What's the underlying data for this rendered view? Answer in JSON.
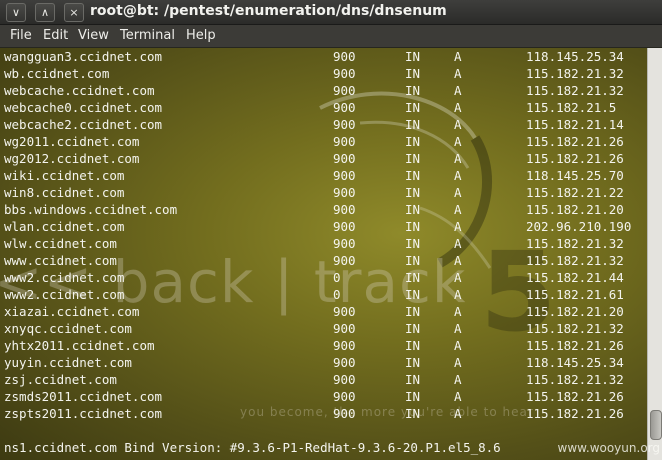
{
  "window": {
    "title": "root@bt: /pentest/enumeration/dns/dnsenum",
    "buttons": [
      "∨",
      "∧",
      "×"
    ]
  },
  "menu": [
    "File",
    "Edit",
    "View",
    "Terminal",
    "Help"
  ],
  "records": [
    {
      "host": "wangguan3.ccidnet.com",
      "ttl": "900",
      "class": "IN",
      "type": "A",
      "ip": "118.145.25.34"
    },
    {
      "host": "wb.ccidnet.com",
      "ttl": "900",
      "class": "IN",
      "type": "A",
      "ip": "115.182.21.32"
    },
    {
      "host": "webcache.ccidnet.com",
      "ttl": "900",
      "class": "IN",
      "type": "A",
      "ip": "115.182.21.32"
    },
    {
      "host": "webcache0.ccidnet.com",
      "ttl": "900",
      "class": "IN",
      "type": "A",
      "ip": "115.182.21.5"
    },
    {
      "host": "webcache2.ccidnet.com",
      "ttl": "900",
      "class": "IN",
      "type": "A",
      "ip": "115.182.21.14"
    },
    {
      "host": "wg2011.ccidnet.com",
      "ttl": "900",
      "class": "IN",
      "type": "A",
      "ip": "115.182.21.26"
    },
    {
      "host": "wg2012.ccidnet.com",
      "ttl": "900",
      "class": "IN",
      "type": "A",
      "ip": "115.182.21.26"
    },
    {
      "host": "wiki.ccidnet.com",
      "ttl": "900",
      "class": "IN",
      "type": "A",
      "ip": "118.145.25.70"
    },
    {
      "host": "win8.ccidnet.com",
      "ttl": "900",
      "class": "IN",
      "type": "A",
      "ip": "115.182.21.22"
    },
    {
      "host": "bbs.windows.ccidnet.com",
      "ttl": "900",
      "class": "IN",
      "type": "A",
      "ip": "115.182.21.20"
    },
    {
      "host": "wlan.ccidnet.com",
      "ttl": "900",
      "class": "IN",
      "type": "A",
      "ip": "202.96.210.190"
    },
    {
      "host": "wlw.ccidnet.com",
      "ttl": "900",
      "class": "IN",
      "type": "A",
      "ip": "115.182.21.32"
    },
    {
      "host": "www.ccidnet.com",
      "ttl": "900",
      "class": "IN",
      "type": "A",
      "ip": "115.182.21.32"
    },
    {
      "host": "www2.ccidnet.com",
      "ttl": "0",
      "class": "IN",
      "type": "A",
      "ip": "115.182.21.44"
    },
    {
      "host": "www2.ccidnet.com",
      "ttl": "0",
      "class": "IN",
      "type": "A",
      "ip": "115.182.21.61"
    },
    {
      "host": "xiazai.ccidnet.com",
      "ttl": "900",
      "class": "IN",
      "type": "A",
      "ip": "115.182.21.20"
    },
    {
      "host": "xnyqc.ccidnet.com",
      "ttl": "900",
      "class": "IN",
      "type": "A",
      "ip": "115.182.21.32"
    },
    {
      "host": "yhtx2011.ccidnet.com",
      "ttl": "900",
      "class": "IN",
      "type": "A",
      "ip": "115.182.21.26"
    },
    {
      "host": "yuyin.ccidnet.com",
      "ttl": "900",
      "class": "IN",
      "type": "A",
      "ip": "118.145.25.34"
    },
    {
      "host": "zsj.ccidnet.com",
      "ttl": "900",
      "class": "IN",
      "type": "A",
      "ip": "115.182.21.32"
    },
    {
      "host": "zsmds2011.ccidnet.com",
      "ttl": "900",
      "class": "IN",
      "type": "A",
      "ip": "115.182.21.26"
    },
    {
      "host": "zspts2011.ccidnet.com",
      "ttl": "900",
      "class": "IN",
      "type": "A",
      "ip": "115.182.21.26"
    }
  ],
  "bind_version_line": "ns1.ccidnet.com Bind Version: #9.3.6-P1-RedHat-9.3.6-20.P1.el5_8.6",
  "wallpaper": {
    "logo_text": "<< back | track",
    "logo_number": "5",
    "tagline": "you become, the more you're able to hear"
  },
  "site_watermark": "www.wooyun.org",
  "colors": {
    "terminal_bg": "#726d1e",
    "terminal_text": "#f4f4ee",
    "titlebar": "#2b2b29",
    "menubar": "#3c3b37"
  }
}
